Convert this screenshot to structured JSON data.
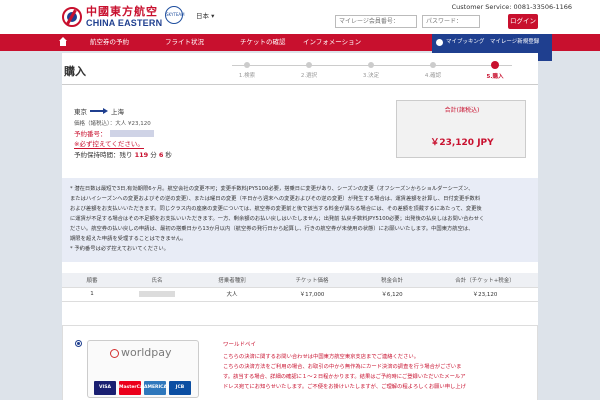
{
  "header": {
    "logo_cn": "中國東方航空",
    "logo_en": "CHINA EASTERN",
    "alliance": "SKYTEAM",
    "language": "日本 ▾",
    "customer_service": "Customer Service: 0081-33506-1166",
    "member_placeholder": "マイレージ会員番号：",
    "password_placeholder": "パスワード：",
    "login_label": "ログイン"
  },
  "nav": {
    "items": [
      "航空券の予約",
      "フライト状況",
      "チケットの確認",
      "インフォメーション"
    ],
    "mybooking": "マイブッキング　マイレージ新規登録"
  },
  "page": {
    "title": "購入",
    "steps": [
      "1.検索",
      "2.選択",
      "3.決定",
      "4.確認",
      "5.購入"
    ],
    "active_step": 4
  },
  "summary": {
    "origin": "東京",
    "destination": "上海",
    "price_line": "価格（諸税込）：大人 ¥23,120",
    "booking_label": "予約番号：",
    "note": "※必ず控えてください。",
    "hold_prefix": "予約保持時間：残り",
    "hold_minutes": "119",
    "hold_min_unit": "分",
    "hold_seconds": "6",
    "hold_sec_unit": "秒",
    "total_label": "合計(諸税込)",
    "total_value": "￥23,120 JPY"
  },
  "notice": {
    "lines": [
      "* 潜在日数は最短で3日,有効期限6ヶ月。航空会社の変更不可；変更手数料JPY5100必要，搭乗日に変更があり、シーズンの変更（オフシーズンからショルダーシーズン、",
      "またはハイシーズンへの変更およびその逆の変更）、または曜日の変更（平日から週末への変更およびその逆の変更）が発生する場合は、運賃差額を計算し、日付変更手数料",
      "および差額をお支払いいただきます。同じクラス内の座席の変更については、航空券の変更前と後で該当する料金が異なる場合には、その差額を頂戴するにあたって、変更後",
      "に運賃が不足する場合はその不足額をお支払いいただきます。一方、剰余額のお払い戻しはいたしません；出発前 払戻手数料JPY5100必要；出発後の払戻しはお問い合わせく",
      "ださい。航空券の払い戻しの申請は、最初の搭乗日から13か月以内（航空券の発行日から起算し、行きの航空券が未使用の状態）にお願いいたします。中国東方航空は、",
      "期限を超えた申請を受理することはできません。",
      "* 予約番号は必ず控えておいてください。"
    ]
  },
  "table": {
    "headers": [
      "順番",
      "氏名",
      "搭乗者種別",
      "チケット価格",
      "税金合計",
      "合計（チケット+税金）"
    ],
    "rows": [
      {
        "index": "1",
        "passenger_type": "大人",
        "ticket": "￥17,000",
        "tax": "￥6,120",
        "total": "￥23,120"
      }
    ]
  },
  "payment": {
    "brand": "worldpay",
    "cards": [
      "VISA",
      "MasterCard",
      "AMERICAN EXPRESS",
      "JCB"
    ],
    "card_colors": [
      "#1a1f71",
      "#eb001b",
      "#2e77bc",
      "#0b4ea2"
    ],
    "title": "ワールドペイ",
    "lines": [
      "こちらの決済に関するお問い合わせは中国東方航空東京支店までご連絡ください。",
      "こちらの決済方法をご利用の場合、お取引の中から無作為にカード決済の調査を行う場合がございま",
      "す。該当する場合、詳細の確認に１〜２日程かかります。結果はご予約時にご登録いただいたメールア",
      "ドレス宛てにお知らせいたします。ご不便をお掛けいたしますが、ご理解の程よろしくお願い申し上げ"
    ]
  }
}
